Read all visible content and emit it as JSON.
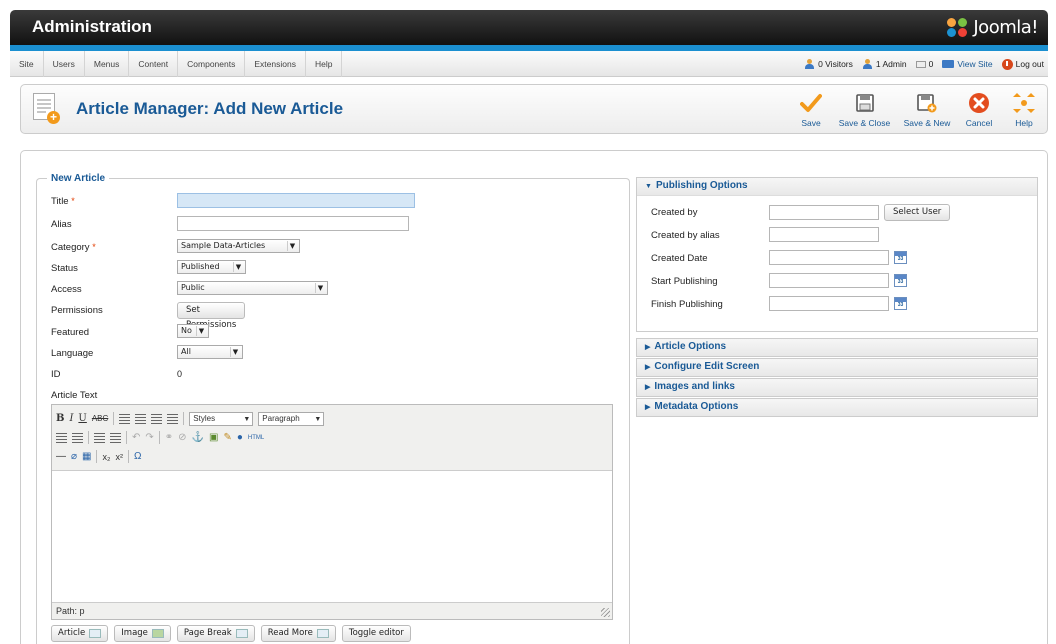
{
  "header": {
    "title": "Administration",
    "logo_text": "Joomla!"
  },
  "menu": {
    "items": [
      "Site",
      "Users",
      "Menus",
      "Content",
      "Components",
      "Extensions",
      "Help"
    ]
  },
  "status": {
    "visitors": "0 Visitors",
    "admins": "1 Admin",
    "messages": "0",
    "view_site": "View Site",
    "logout": "Log out"
  },
  "toolbar": {
    "page_title": "Article Manager: Add New Article",
    "save": "Save",
    "save_close": "Save & Close",
    "save_new": "Save & New",
    "cancel": "Cancel",
    "help": "Help"
  },
  "form": {
    "legend": "New Article",
    "title_label": "Title",
    "title_value": "",
    "alias_label": "Alias",
    "alias_value": "",
    "category_label": "Category",
    "category_value": "Sample Data-Articles",
    "status_label": "Status",
    "status_value": "Published",
    "access_label": "Access",
    "access_value": "Public",
    "permissions_label": "Permissions",
    "permissions_button": "Set Permissions",
    "featured_label": "Featured",
    "featured_value": "No",
    "language_label": "Language",
    "language_value": "All",
    "id_label": "ID",
    "id_value": "0",
    "article_text_label": "Article Text",
    "required_mark": "*"
  },
  "editor": {
    "styles": "Styles",
    "format": "Paragraph",
    "path": "Path: p",
    "buttons": [
      "Article",
      "Image",
      "Page Break",
      "Read More",
      "Toggle editor"
    ]
  },
  "publishing": {
    "header": "Publishing Options",
    "created_by": "Created by",
    "select_user": "Select User",
    "created_by_alias": "Created by alias",
    "created_date": "Created Date",
    "start_publishing": "Start Publishing",
    "finish_publishing": "Finish Publishing"
  },
  "panels": [
    "Article Options",
    "Configure Edit Screen",
    "Images and links",
    "Metadata Options"
  ],
  "colors": {
    "accent": "#1a5a96",
    "brand_blue": "#1b8fd0",
    "required": "#e23c00"
  }
}
